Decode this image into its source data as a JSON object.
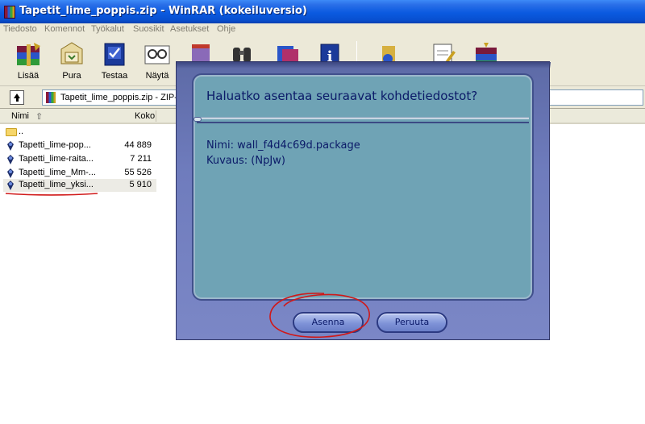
{
  "window": {
    "title": "Tapetit_lime_poppis.zip - WinRAR (kokeiluversio)"
  },
  "menu": [
    "Tiedosto",
    "Komennot",
    "Työkalut",
    "Suosikit",
    "Asetukset",
    "Ohje"
  ],
  "toolbar": {
    "buttons": [
      {
        "label": "Lisää",
        "icon": "add-archive-icon"
      },
      {
        "label": "Pura",
        "icon": "extract-icon"
      },
      {
        "label": "Testaa",
        "icon": "test-icon"
      },
      {
        "label": "Näytä",
        "icon": "view-icon"
      }
    ]
  },
  "address": {
    "path": "Tapetit_lime_poppis.zip - ZIP-a"
  },
  "columns": {
    "name": "Nimi",
    "size": "Koko"
  },
  "files": [
    {
      "name": "..",
      "size": "",
      "type": "folder"
    },
    {
      "name": "Tapetti_lime-pop...",
      "size": "44 889"
    },
    {
      "name": "Tapetti_lime-raita...",
      "size": "7 211"
    },
    {
      "name": "Tapetti_lime_Mm-...",
      "size": "55 526"
    },
    {
      "name": "Tapetti_lime_yksi...",
      "size": "5 910",
      "selected": true
    }
  ],
  "dialog": {
    "question": "Haluatko asentaa seuraavat kohdetiedostot?",
    "name_line": "Nimi:  wall_f4d4c69d.package",
    "desc_line": "Kuvaus:  (NpJw)",
    "install_label": "Asenna",
    "cancel_label": "Peruuta"
  },
  "colors": {
    "titlebar": "#0a5ae0",
    "dialog_frame": "#6f7cbd",
    "dialog_panel": "#6fa3b5",
    "dialog_text": "#0b1a68",
    "annotation": "#d01818"
  }
}
